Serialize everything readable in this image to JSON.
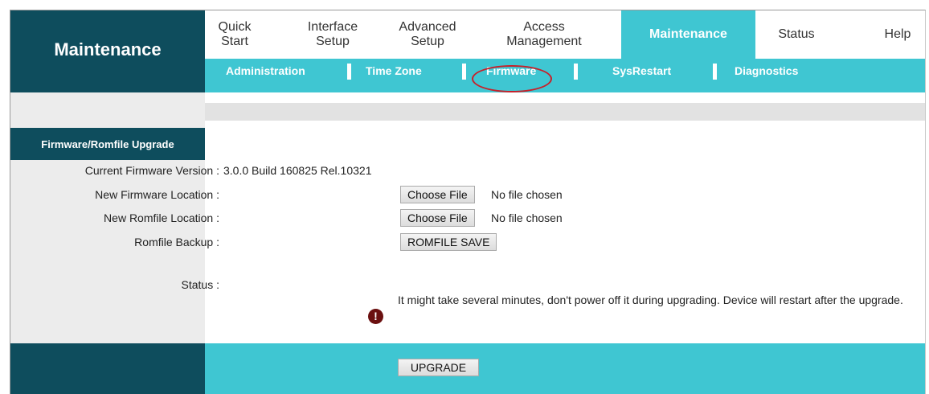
{
  "brand": "Maintenance",
  "nav": [
    "Quick\nStart",
    "Interface\nSetup",
    "Advanced\nSetup",
    "Access\nManagement",
    "Maintenance",
    "Status",
    "Help"
  ],
  "subnav": [
    "Administration",
    "Time Zone",
    "Firmware",
    "SysRestart",
    "Diagnostics"
  ],
  "section": "Firmware/Romfile Upgrade",
  "fields": {
    "current_label": "Current Firmware Version :",
    "current_value": "3.0.0 Build 160825 Rel.10321",
    "fw_label": "New Firmware Location :",
    "fw_button": "Choose File",
    "fw_file": "No file chosen",
    "rom_label": "New Romfile Location :",
    "rom_button": "Choose File",
    "rom_file": "No file chosen",
    "backup_label": "Romfile Backup :",
    "backup_button": "ROMFILE SAVE",
    "status_label": "Status :",
    "status_text": "It might take several minutes, don't power off it during upgrading. Device will restart after the upgrade."
  },
  "upgrade_button": "UPGRADE",
  "colors": {
    "dark_teal": "#0e4d5d",
    "accent": "#3fc6d2",
    "highlight": "#c7202a"
  }
}
